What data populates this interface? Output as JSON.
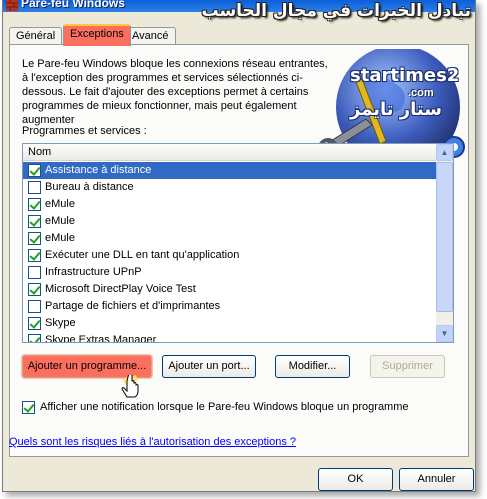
{
  "window": {
    "title": "Pare-feu Windows",
    "watermark_arabic": "تبادل الخبرات في مجال الحاسب"
  },
  "tabs": [
    {
      "label": "Général",
      "active": false
    },
    {
      "label": "Exceptions",
      "active": true
    },
    {
      "label": "Avancé",
      "active": false
    }
  ],
  "description": "Le Pare-feu Windows bloque les connexions réseau entrantes, à l'exception des programmes et services sélectionnés ci-dessous. Le fait d'ajouter des exceptions permet à certains programmes de mieux fonctionner, mais peut également augmenter",
  "logo": {
    "text": "startimes2",
    "domain": ".com",
    "arabic": "ستار تايمز"
  },
  "programs_label": "Programmes et services :",
  "list": {
    "column_header": "Nom",
    "items": [
      {
        "label": "Assistance à distance",
        "checked": true,
        "selected": true
      },
      {
        "label": "Bureau à distance",
        "checked": false,
        "selected": false
      },
      {
        "label": "eMule",
        "checked": true,
        "selected": false
      },
      {
        "label": "eMule",
        "checked": true,
        "selected": false
      },
      {
        "label": "eMule",
        "checked": true,
        "selected": false
      },
      {
        "label": "Exécuter une DLL en tant qu'application",
        "checked": true,
        "selected": false
      },
      {
        "label": "Infrastructure UPnP",
        "checked": false,
        "selected": false
      },
      {
        "label": "Microsoft DirectPlay Voice Test",
        "checked": true,
        "selected": false
      },
      {
        "label": "Partage de fichiers et d'imprimantes",
        "checked": false,
        "selected": false
      },
      {
        "label": "Skype",
        "checked": true,
        "selected": false
      },
      {
        "label": "Skype Extras Manager",
        "checked": true,
        "selected": false
      }
    ]
  },
  "buttons": {
    "add_program": "Ajouter un programme...",
    "add_port": "Ajouter un port...",
    "modify": "Modifier...",
    "delete": "Supprimer"
  },
  "notify": {
    "label": "Afficher une notification lorsque le Pare-feu Windows bloque un programme",
    "checked": true
  },
  "help_link": "Quels sont les risques liés à l'autorisation des exceptions ?",
  "dialog_buttons": {
    "ok": "OK",
    "cancel": "Annuler"
  },
  "colors": {
    "highlight": "#fc6f5f",
    "selection": "#316ac5",
    "link": "#0000ff"
  }
}
